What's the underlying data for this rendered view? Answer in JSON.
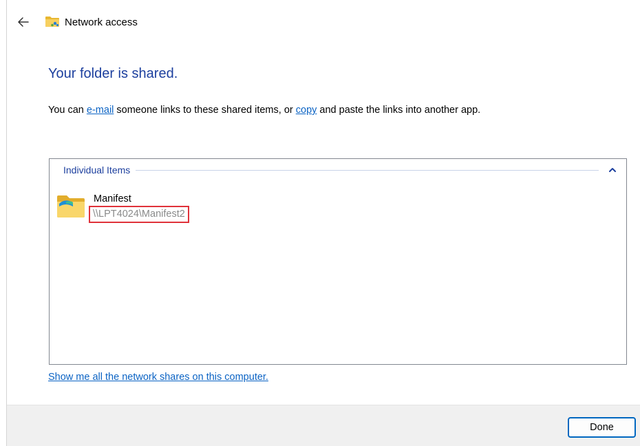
{
  "window": {
    "title": "Network access",
    "back_icon": "arrow-left-icon",
    "title_icon": "network-folder-icon"
  },
  "main": {
    "heading": "Your folder is shared.",
    "description": {
      "prefix": "You can ",
      "email_link": "e-mail",
      "middle": " someone links to these shared items, or ",
      "copy_link": "copy",
      "suffix": " and paste the links into another app."
    }
  },
  "items_panel": {
    "group_label": "Individual Items",
    "collapse_icon": "chevron-up-icon",
    "items": [
      {
        "name": "Manifest",
        "path": "\\\\LPT4024\\Manifest2",
        "icon": "shared-folder-icon",
        "highlighted": true
      }
    ]
  },
  "show_shares_link": "Show me all the network shares on this computer.",
  "footer": {
    "done_label": "Done"
  },
  "colors": {
    "heading": "#1c3f9e",
    "link": "#0b63c4",
    "highlight_box": "#e0323a",
    "button_border": "#0067c0",
    "footer_bg": "#f0f0f0"
  }
}
